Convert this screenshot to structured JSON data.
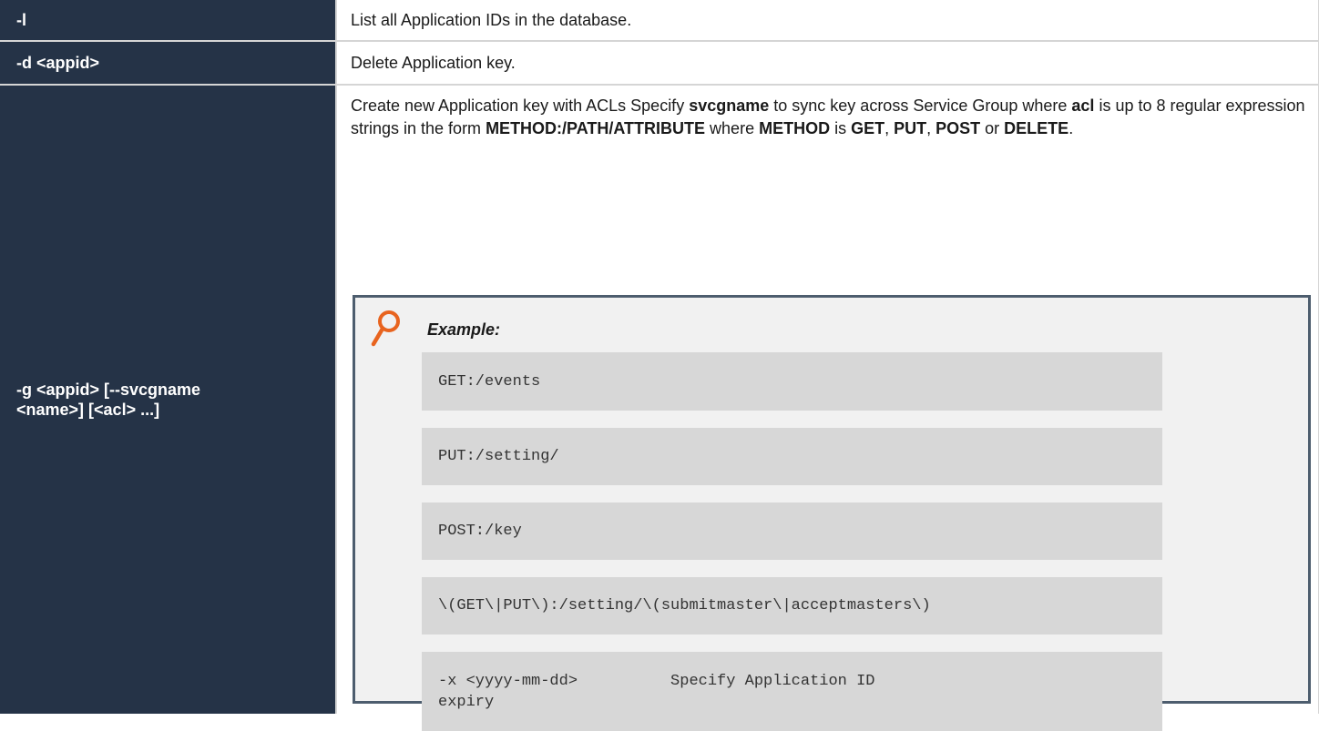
{
  "rows": [
    {
      "option": "-l",
      "description": "List all Application IDs in the database."
    },
    {
      "option": "-d <appid>",
      "description": "Delete Application key."
    },
    {
      "option": "-g <appid> [--svcgname <name>] [<acl> ...]",
      "description_parts": [
        {
          "text": "Create new Application key with ACLs Specify ",
          "bold": false
        },
        {
          "text": "svcgname",
          "bold": true
        },
        {
          "text": " to sync key across Service Group where ",
          "bold": false
        },
        {
          "text": "acl",
          "bold": true
        },
        {
          "text": " is up to 8 regular expression strings in the form ",
          "bold": false
        },
        {
          "text": "METHOD:/PATH/ATTRIBUTE",
          "bold": true
        },
        {
          "text": " where ",
          "bold": false
        },
        {
          "text": "METHOD",
          "bold": true
        },
        {
          "text": " is ",
          "bold": false
        },
        {
          "text": "GET",
          "bold": true
        },
        {
          "text": ", ",
          "bold": false
        },
        {
          "text": "PUT",
          "bold": true
        },
        {
          "text": ", ",
          "bold": false
        },
        {
          "text": "POST",
          "bold": true
        },
        {
          "text": " or ",
          "bold": false
        },
        {
          "text": "DELETE",
          "bold": true
        },
        {
          "text": ".",
          "bold": false
        }
      ],
      "example": {
        "icon": "magnifier-icon",
        "heading": "Example:",
        "code_lines": [
          "GET:/events",
          "PUT:/setting/",
          "POST:/key",
          "\\(GET\\|PUT\\):/setting/\\(submitmaster\\|acceptmasters\\)",
          "-x <yyyy-mm-dd>          Specify Application ID\nexpiry"
        ]
      }
    }
  ],
  "colors": {
    "key_column_bg": "#253347",
    "example_border": "#4d5d6e",
    "example_bg": "#f1f1f1",
    "code_bg": "#d7d7d7",
    "icon_color": "#e8641f"
  }
}
